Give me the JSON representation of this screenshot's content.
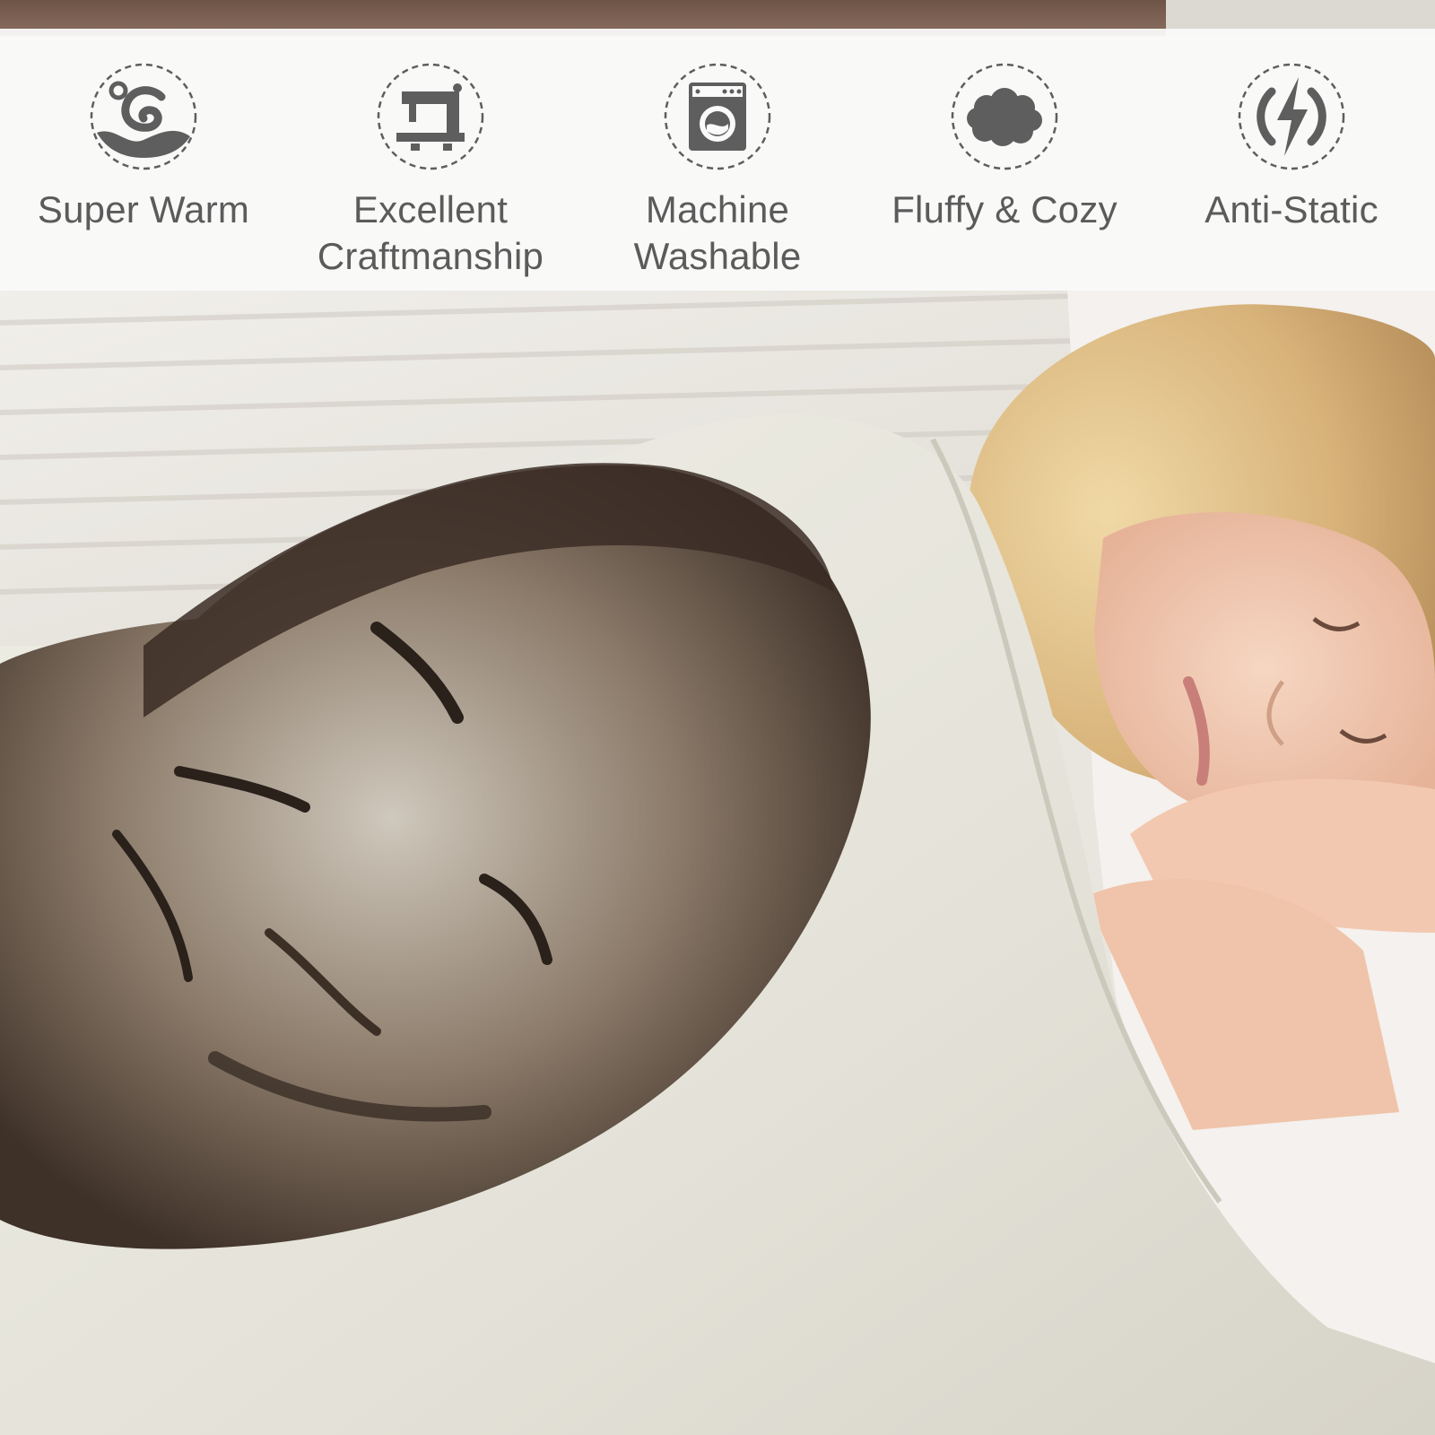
{
  "features": [
    {
      "icon": "thermometer-wave-icon",
      "lines": [
        "Super Warm"
      ]
    },
    {
      "icon": "sewing-machine-icon",
      "lines": [
        "Excellent",
        "Craftmanship"
      ]
    },
    {
      "icon": "washing-machine-icon",
      "lines": [
        "Machine",
        "Washable"
      ]
    },
    {
      "icon": "cloud-icon",
      "lines": [
        "Fluffy & Cozy"
      ]
    },
    {
      "icon": "lightning-bolt-icon",
      "lines": [
        "Anti-Static"
      ]
    }
  ],
  "colors": {
    "icon_gray": "#5e5e5e",
    "label_gray": "#5b5b5b",
    "banner_white": "#fafafa",
    "blanket_cream": "#e8e6dd",
    "hair_blonde": "#d9b57c",
    "skin": "#f0c8ae"
  }
}
